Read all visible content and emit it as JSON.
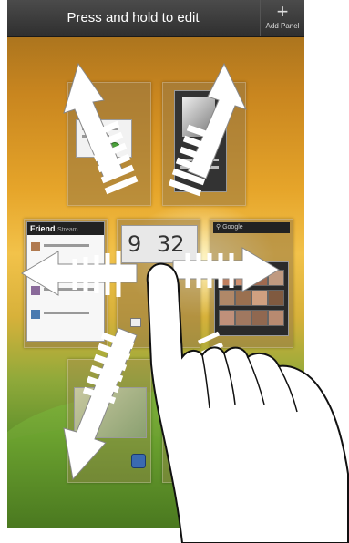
{
  "topbar": {
    "title": "Press and hold to edit",
    "add_panel_label": "Add Panel",
    "plus_glyph": "+"
  },
  "widgets": {
    "friend_title": "Friend",
    "friend_subtitle": "Stream",
    "clock_hours": "9",
    "clock_minutes": "32",
    "google_search": "Google"
  }
}
